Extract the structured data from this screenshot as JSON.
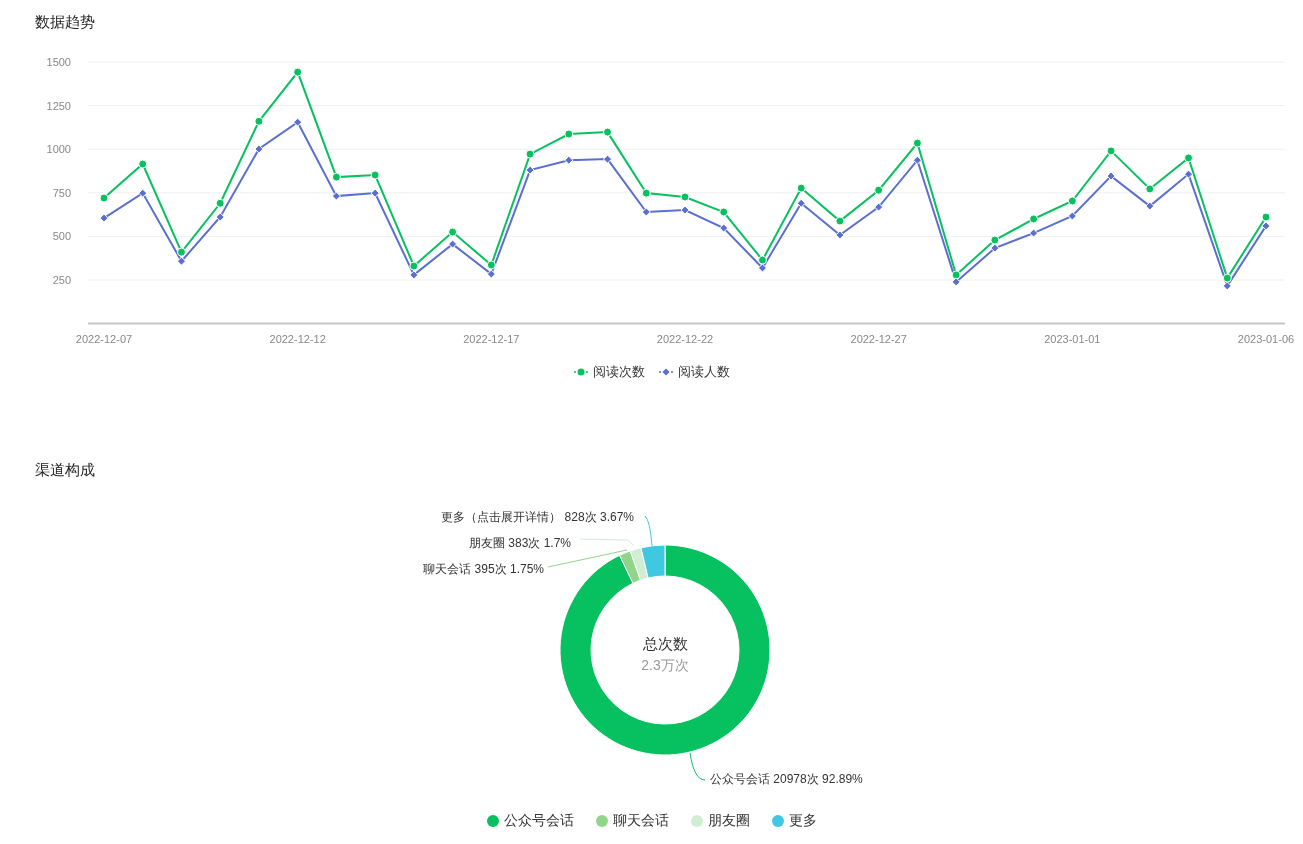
{
  "trend": {
    "title": "数据趋势",
    "chart_data": {
      "type": "line",
      "categories": [
        "2022-12-07",
        null,
        null,
        null,
        null,
        "2022-12-12",
        null,
        null,
        null,
        null,
        "2022-12-17",
        null,
        null,
        null,
        null,
        "2022-12-22",
        null,
        null,
        null,
        null,
        "2022-12-27",
        null,
        null,
        null,
        null,
        "2023-01-01",
        null,
        null,
        null,
        null,
        "2023-01-06"
      ],
      "yticks": [
        250,
        500,
        750,
        1000,
        1250,
        1500
      ],
      "ylim": [
        0,
        1500
      ],
      "grid": true,
      "series": [
        {
          "name": "阅读次数",
          "color": "#07c160",
          "marker": "circle",
          "values": [
            720,
            915,
            410,
            690,
            1160,
            1442,
            840,
            852,
            330,
            525,
            336,
            972,
            1087,
            1098,
            748,
            726,
            640,
            364,
            777,
            588,
            765,
            1035,
            279,
            479,
            600,
            703,
            990,
            772,
            950,
            261,
            611
          ]
        },
        {
          "name": "阅读人数",
          "color": "#5b6fd0",
          "marker": "diamond",
          "values": [
            605,
            748,
            358,
            611,
            1001,
            1155,
            731,
            748,
            279,
            456,
            284,
            880,
            937,
            943,
            640,
            651,
            548,
            319,
            690,
            508,
            668,
            937,
            239,
            433,
            519,
            617,
            846,
            674,
            857,
            216,
            560
          ]
        }
      ]
    }
  },
  "channels": {
    "title": "渠道构成",
    "center_label": "总次数",
    "center_value": "2.3万次",
    "chart_data": {
      "type": "donut",
      "categories": [
        "公众号会话",
        "聊天会话",
        "朋友圈",
        "更多"
      ],
      "values": [
        92.89,
        1.75,
        1.7,
        3.67
      ]
    },
    "slices": [
      {
        "color": "#07c160"
      },
      {
        "color": "#91d58b"
      },
      {
        "color": "#cfeed2"
      },
      {
        "color": "#40c8e0"
      }
    ],
    "slice_labels": [
      "更多（点击展开详情） 828次 3.67%",
      "朋友圈 383次 1.7%",
      "聊天会话 395次 1.75%",
      "公众号会话 20978次 92.89%"
    ]
  }
}
